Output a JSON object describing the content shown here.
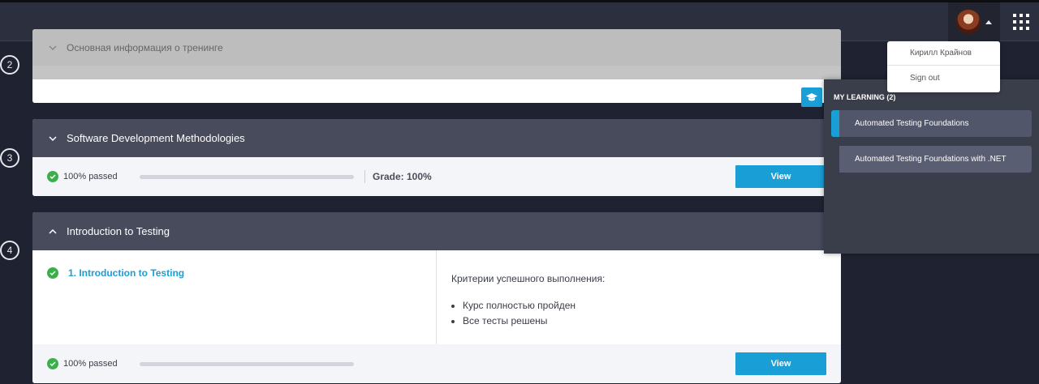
{
  "topbar": {
    "avatar_alt": "user avatar"
  },
  "steps": [
    "2",
    "3",
    "4"
  ],
  "modules": [
    {
      "title": "Основная информация о тренинге",
      "expanded": true
    },
    {
      "title": "Software Development Methodologies",
      "expanded": false,
      "status": "100% passed",
      "progress": 1.0,
      "grade": "Grade: 100%",
      "view_label": "View"
    },
    {
      "title": "Introduction to Testing",
      "expanded": true,
      "lesson": "1. Introduction to Testing",
      "criteria_title": "Критерии успешного выполнения:",
      "criteria": [
        "Курс полностью пройден",
        "Все тесты решены"
      ],
      "status": "100% passed",
      "progress": 1.0,
      "view_label": "View"
    }
  ],
  "user_menu": {
    "name": "Кирилл Крайнов",
    "sign_out": "Sign out"
  },
  "my_learning": {
    "title": "MY LEARNING (2)",
    "courses": [
      {
        "label": "Automated Testing Foundations",
        "active": true
      },
      {
        "label": "Automated Testing Foundations with .NET",
        "active": false
      }
    ]
  },
  "colors": {
    "accent": "#1a9ed6",
    "success": "#3bb04a",
    "header_bg": "#474b5c",
    "page_bg": "#1f2230"
  }
}
